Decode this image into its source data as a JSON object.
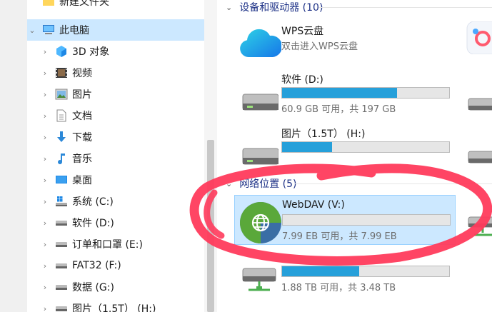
{
  "nav": {
    "items": [
      {
        "label": "新建文件夹",
        "icon": "folder-icon",
        "expandable": false
      },
      {
        "label": "此电脑",
        "icon": "computer-icon",
        "expandable": true,
        "expanded": true,
        "selected": true
      },
      {
        "label": "3D 对象",
        "icon": "3d-objects-icon",
        "expandable": true
      },
      {
        "label": "视频",
        "icon": "video-icon",
        "expandable": true
      },
      {
        "label": "图片",
        "icon": "pictures-icon",
        "expandable": true
      },
      {
        "label": "文档",
        "icon": "documents-icon",
        "expandable": true
      },
      {
        "label": "下载",
        "icon": "download-icon",
        "expandable": true
      },
      {
        "label": "音乐",
        "icon": "music-icon",
        "expandable": true
      },
      {
        "label": "桌面",
        "icon": "desktop-icon",
        "expandable": true
      },
      {
        "label": "系统 (C:)",
        "icon": "system-drive-icon",
        "expandable": true
      },
      {
        "label": "软件 (D:)",
        "icon": "drive-icon",
        "expandable": true
      },
      {
        "label": "订单和口罩 (E:)",
        "icon": "drive-icon",
        "expandable": true
      },
      {
        "label": "FAT32 (F:)",
        "icon": "drive-icon",
        "expandable": true
      },
      {
        "label": "数据 (G:)",
        "icon": "drive-icon",
        "expandable": true
      },
      {
        "label": "图片（1.5T） (H:)",
        "icon": "drive-icon",
        "expandable": true
      }
    ]
  },
  "devices": {
    "header": "设备和驱动器 (10)",
    "tiles": [
      {
        "name": "WPS云盘",
        "detail": "双击进入WPS云盘",
        "icon": "cloud-icon"
      },
      {
        "name": "软件 (D:)",
        "used_fraction": 0.69,
        "size": "60.9 GB 可用，共 197 GB",
        "icon": "hard-drive-icon"
      },
      {
        "name": "图片（1.5T） (H:)",
        "used_fraction": 0.3,
        "size": "",
        "icon": "hard-drive-icon"
      }
    ]
  },
  "network": {
    "header": "网络位置 (5)",
    "tiles": [
      {
        "name": "WebDAV (V:)",
        "used_fraction": 0.0,
        "size": "7.99 EB 可用，共 7.99 EB",
        "icon": "globe-icon",
        "selected": true
      },
      {
        "name": "",
        "used_fraction": 0.46,
        "size": "1.88 TB 可用，共 3.48 TB",
        "icon": "network-drive-icon"
      }
    ]
  },
  "colors": {
    "accent": "#26a0da",
    "selection": "#cce8ff",
    "annotation": "#ff3b5c"
  }
}
